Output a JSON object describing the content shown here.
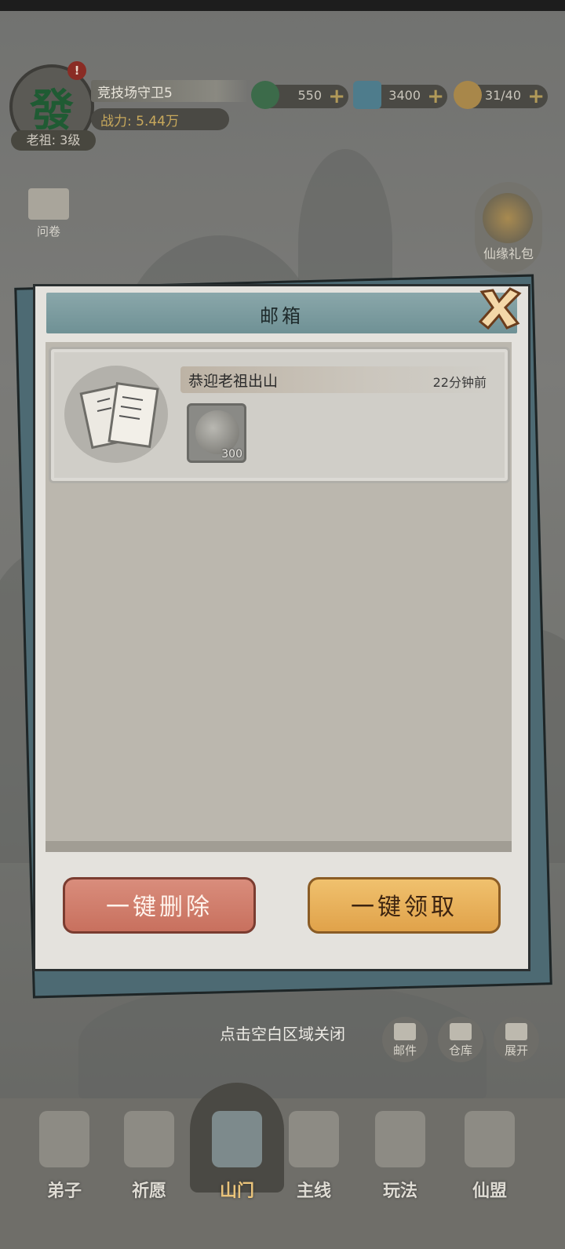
{
  "header": {
    "avatar_glyph": "發",
    "alert": "!",
    "level": "老祖: 3级",
    "name": "竞技场守卫5",
    "power": "战力: 5.44万"
  },
  "resources": [
    {
      "icon": "jade-coin-icon",
      "value": "550",
      "color": "#3c6b4a"
    },
    {
      "icon": "spirit-stone-icon",
      "value": "3400",
      "color": "#4e7c8c"
    },
    {
      "icon": "gourd-icon",
      "value": "31/40",
      "color": "#a8874a"
    }
  ],
  "side": {
    "survey": "问卷",
    "gift": "仙缘礼包"
  },
  "mailbox": {
    "title": "邮箱",
    "mails": [
      {
        "subject": "恭迎老祖出山",
        "time": "22分钟前",
        "attachment_qty": "300"
      }
    ],
    "delete_all": "一键删除",
    "claim_all": "一键领取"
  },
  "hint": "点击空白区域关闭",
  "tools": [
    "邮件",
    "仓库",
    "展开"
  ],
  "nav": [
    "弟子",
    "祈愿",
    "山门",
    "主线",
    "玩法",
    "仙盟"
  ]
}
